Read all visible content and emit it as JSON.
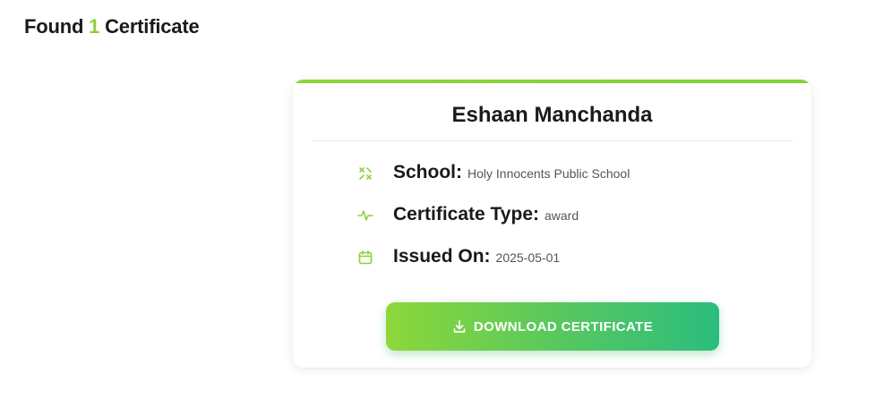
{
  "results": {
    "prefix": "Found",
    "count": "1",
    "suffix": "Certificate"
  },
  "certificate": {
    "name": "Eshaan Manchanda",
    "details": [
      {
        "icon": "school-icon",
        "label": "School:",
        "value": "Holy Innocents Public School"
      },
      {
        "icon": "activity-icon",
        "label": "Certificate Type:",
        "value": "award"
      },
      {
        "icon": "calendar-icon",
        "label": "Issued On:",
        "value": "2025-05-01"
      }
    ],
    "download_label": "DOWNLOAD CERTIFICATE"
  },
  "colors": {
    "accent": "#8dd13a",
    "button_gradient_start": "#8dd73a",
    "button_gradient_end": "#2bbd7e",
    "text": "#1a1a1a"
  }
}
